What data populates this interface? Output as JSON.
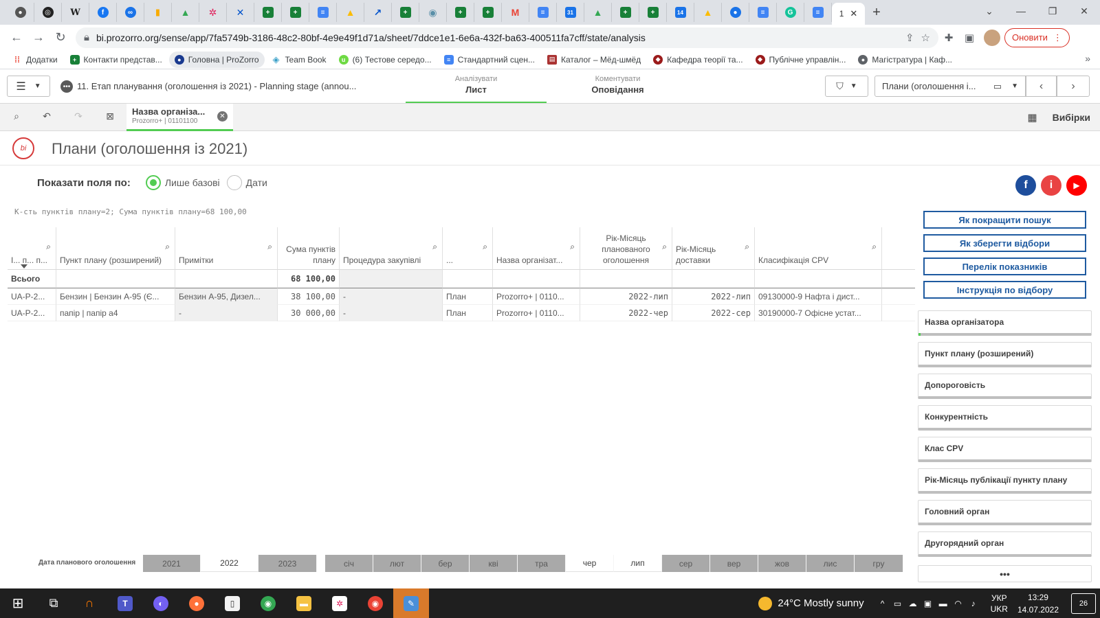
{
  "browser": {
    "active_tab_label": "1",
    "url": "bi.prozorro.org/sense/app/7fa5749b-3186-48c2-80bf-4e9e49f1d71a/sheet/7ddce1e1-6e6a-432f-ba63-400511fa7cff/state/analysis",
    "update_label": "Оновити",
    "bookmarks": [
      {
        "label": "Додатки"
      },
      {
        "label": "Контакти представ..."
      },
      {
        "label": "Головна | ProZorro"
      },
      {
        "label": "Team Book"
      },
      {
        "label": "(6) Тестове середо..."
      },
      {
        "label": "Стандартний сцен..."
      },
      {
        "label": "Каталог – Мёд-шмёд"
      },
      {
        "label": "Кафедра теорії та..."
      },
      {
        "label": "Публічне управлін..."
      },
      {
        "label": "Магістратура | Каф..."
      }
    ]
  },
  "qlik": {
    "app_title": "11. Етап планування (оголошення із 2021) - Planning stage (annou...",
    "modes": [
      {
        "sub": "Аналізувати",
        "main": "Лист"
      },
      {
        "sub": "Коментувати",
        "main": "Оповідання"
      }
    ],
    "sheet_selector": "Плани (оголошення і...",
    "selection_chip": {
      "title": "Назва організа...",
      "value": "Prozorro+ | 01101100"
    },
    "selections_label": "Вибірки"
  },
  "sheet": {
    "title": "Плани (оголошення із 2021)",
    "show_fields_label": "Показати поля по:",
    "options": [
      "Лише базові",
      "Дати"
    ],
    "kpi_text": "К-сть пунктів плану=2; Сума пунктів плану=68 100,00",
    "table": {
      "headers": [
        "І... п... п...",
        "Пункт плану (розширений)",
        "Примітки",
        "Сума пунктів плану",
        "Процедура закупівлі",
        "...",
        "Назва організат...",
        "Рік-Місяць планованого оголошення",
        "Рік-Місяць доставки",
        "Класифікація CPV"
      ],
      "totals": [
        "Всього",
        "",
        "",
        "68 100,00",
        "",
        "",
        "",
        "",
        "",
        ""
      ],
      "rows": [
        [
          "UA-P-2...",
          "Бензин | Бензин А-95 (Є...",
          "Бензин А-95, Дизел...",
          "38 100,00",
          "-",
          "План",
          "Prozorro+ | 0110...",
          "2022-лип",
          "2022-лип",
          "09130000-9 Нафта і дист..."
        ],
        [
          "UA-P-2...",
          "папір | папір а4",
          "-",
          "30 000,00",
          "-",
          "План",
          "Prozorro+ | 0110...",
          "2022-чер",
          "2022-сер",
          "30190000-7 Офісне устат..."
        ]
      ]
    },
    "right_buttons": [
      "Як покращити пошук",
      "Як зберегти відбори",
      "Перелік показників",
      "Інструкція по відбору"
    ],
    "filters": [
      "Назва організатора",
      "Пункт плану (розширений)",
      "Допороговість",
      "Конкурентність",
      "Клас CPV",
      "Рік-Місяць публікації пункту плану",
      "Головний орган",
      "Другорядний орган"
    ],
    "more_label": "•••",
    "date_filter": {
      "label": "Дата планового оголошення",
      "years": [
        "2021",
        "2022",
        "2023"
      ],
      "months": [
        "січ",
        "лют",
        "бер",
        "кві",
        "тра",
        "чер",
        "лип",
        "сер",
        "вер",
        "жов",
        "лис",
        "гру"
      ]
    }
  },
  "taskbar": {
    "weather": "24°C  Mostly sunny",
    "lang_1": "УКР",
    "lang_2": "UKR",
    "time": "13:29",
    "date": "14.07.2022",
    "notifications": "26"
  },
  "colors": {
    "accent_green": "#52cc52",
    "link_blue": "#1e5aa0",
    "facebook": "#3b5998",
    "info_red": "#e53935",
    "youtube_red": "#ff0000"
  }
}
